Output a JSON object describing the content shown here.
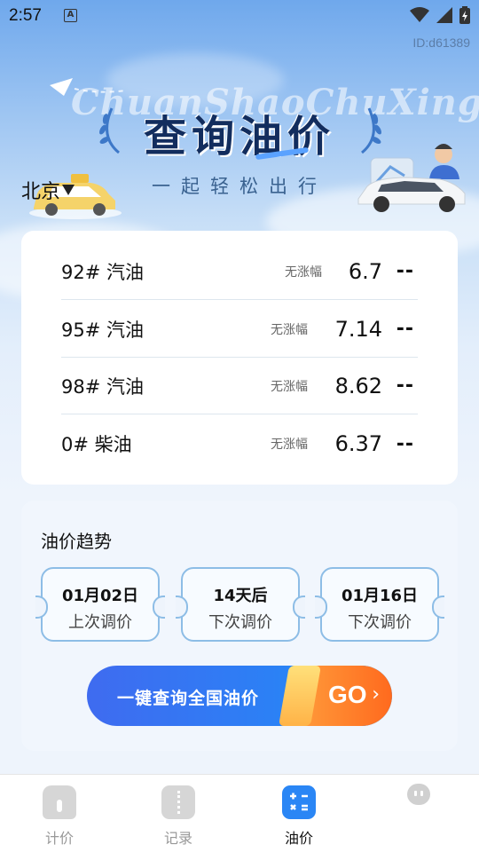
{
  "status_bar": {
    "time": "2:57",
    "notification_glyph": "A"
  },
  "device_id": "ID:d61389",
  "header": {
    "script_watermark": "ChuanShaoChuXing",
    "title": "查询油价",
    "subtitle": "一起轻松出行"
  },
  "city": {
    "name": "北京"
  },
  "prices": [
    {
      "name": "92# 汽油",
      "change": "无涨幅",
      "value": "6.7",
      "dash": "--"
    },
    {
      "name": "95# 汽油",
      "change": "无涨幅",
      "value": "7.14",
      "dash": "--"
    },
    {
      "name": "98# 汽油",
      "change": "无涨幅",
      "value": "8.62",
      "dash": "--"
    },
    {
      "name": "0# 柴油",
      "change": "无涨幅",
      "value": "6.37",
      "dash": "--"
    }
  ],
  "trend": {
    "title": "油价趋势",
    "tickets": [
      {
        "top": "01月02日",
        "bottom": "上次调价"
      },
      {
        "top": "14天后",
        "bottom": "下次调价"
      },
      {
        "top": "01月16日",
        "bottom": "下次调价"
      }
    ],
    "query_button": "一键查询全国油价",
    "go_label": "GO",
    "go_arrow": "›"
  },
  "nav": [
    {
      "label": "计价",
      "icon": "home-icon",
      "active": false
    },
    {
      "label": "记录",
      "icon": "ticket-icon",
      "active": false
    },
    {
      "label": "油价",
      "icon": "calculator-icon",
      "active": true
    }
  ],
  "colors": {
    "accent": "#2a86f5",
    "title": "#122d5e",
    "go_orange": "#ff7a28"
  }
}
